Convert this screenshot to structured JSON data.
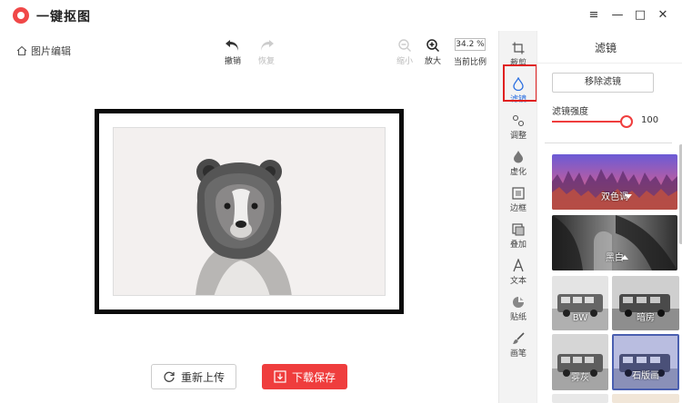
{
  "window": {
    "title": "一键抠图",
    "controls": [
      "≡",
      "—",
      "□",
      "✕"
    ]
  },
  "toolbar": {
    "edit_label": "图片编辑",
    "undo": "撤销",
    "redo": "恢复",
    "zoom_out": "缩小",
    "zoom_in": "放大",
    "zoom_value": "34.2 %",
    "zoom_label": "当前比例"
  },
  "bottom": {
    "reupload": "重新上传",
    "save": "下载保存"
  },
  "sidemenu": {
    "items": [
      {
        "label": "裁剪",
        "icon": "crop-icon"
      },
      {
        "label": "滤镜",
        "icon": "filter-drop-icon",
        "active": true
      },
      {
        "label": "调整",
        "icon": "adjust-icon"
      },
      {
        "label": "虚化",
        "icon": "blur-drop-icon"
      },
      {
        "label": "边框",
        "icon": "frame-icon"
      },
      {
        "label": "叠加",
        "icon": "overlay-icon"
      },
      {
        "label": "文本",
        "icon": "text-icon"
      },
      {
        "label": "贴纸",
        "icon": "sticker-icon"
      },
      {
        "label": "画笔",
        "icon": "brush-icon"
      }
    ]
  },
  "panel": {
    "title": "滤镜",
    "remove": "移除滤镜",
    "strength_label": "滤镜强度",
    "strength_value": "100",
    "strength_fraction": 1.0,
    "filters": [
      {
        "label": "双色调"
      },
      {
        "label": "黑白"
      },
      {
        "label": "BW"
      },
      {
        "label": "暗房"
      },
      {
        "label": "雾灰"
      },
      {
        "label": "石版画"
      }
    ]
  },
  "colors": {
    "accent": "#ef3d3d",
    "active_menu": "#2b6fe0"
  }
}
